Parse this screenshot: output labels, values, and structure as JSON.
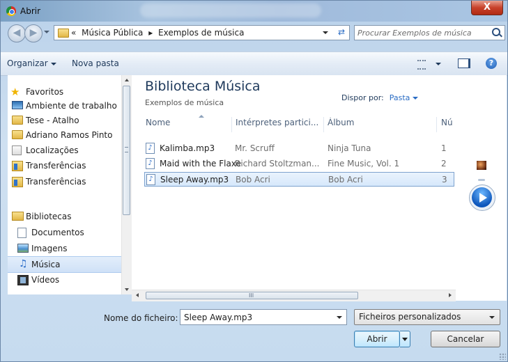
{
  "window": {
    "title": "Abrir",
    "close_glyph": "X"
  },
  "address_bar": {
    "prefix": "«",
    "crumbs": [
      "Música Pública",
      "Exemplos de música"
    ],
    "separator": "▸"
  },
  "search": {
    "placeholder": "Procurar Exemplos de música"
  },
  "toolbar": {
    "organize_label": "Organizar",
    "new_folder_label": "Nova pasta"
  },
  "nav_pane": {
    "favorites_label": "Favoritos",
    "favorites": [
      {
        "label": "Ambiente de trabalho",
        "icon": "desktop-icon"
      },
      {
        "label": "Tese - Atalho",
        "icon": "folder-icon"
      },
      {
        "label": "Adriano Ramos Pinto",
        "icon": "folder-icon"
      },
      {
        "label": "Localizações",
        "icon": "recent-places-icon"
      },
      {
        "label": "Transferências",
        "icon": "downloads-icon"
      },
      {
        "label": "Transferências",
        "icon": "downloads-icon"
      }
    ],
    "libraries_label": "Bibliotecas",
    "libraries": [
      {
        "label": "Documentos",
        "icon": "documents-icon"
      },
      {
        "label": "Imagens",
        "icon": "pictures-icon"
      },
      {
        "label": "Música",
        "icon": "music-icon",
        "selected": true
      },
      {
        "label": "Vídeos",
        "icon": "videos-icon"
      }
    ]
  },
  "library": {
    "title": "Biblioteca Música",
    "subtitle": "Exemplos de música",
    "arrange_label": "Dispor por:",
    "arrange_value": "Pasta"
  },
  "columns": [
    "Nome",
    "Intérpretes partici...",
    "Álbum",
    "Nú"
  ],
  "files": [
    {
      "name": "Kalimba.mp3",
      "artist": "Mr. Scruff",
      "album": "Ninja Tuna",
      "number": "1",
      "selected": false
    },
    {
      "name": "Maid with the Flaxe...",
      "artist": "Richard Stoltzman...",
      "album": "Fine Music, Vol. 1",
      "number": "2",
      "selected": false
    },
    {
      "name": "Sleep Away.mp3",
      "artist": "Bob Acri",
      "album": "Bob Acri",
      "number": "3",
      "selected": true
    }
  ],
  "footer": {
    "filename_label": "Nome do ficheiro:",
    "filename_value": "Sleep Away.mp3",
    "filter_value": "Ficheiros personalizados",
    "open_label": "Abrir",
    "cancel_label": "Cancelar"
  },
  "scroll": {
    "h_grip": "III"
  },
  "colors": {
    "title_blue": "#1e395b",
    "link_blue": "#2a6cc4",
    "selection": "#d6e8fb"
  }
}
